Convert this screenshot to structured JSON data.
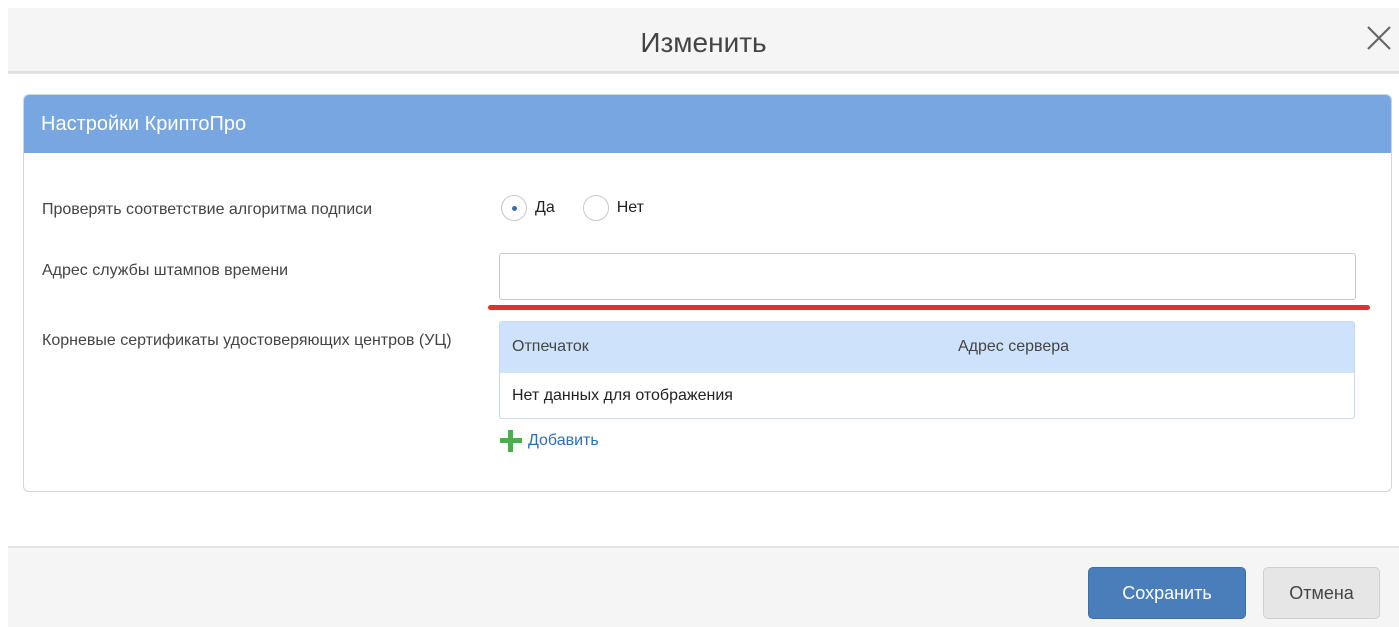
{
  "dialog": {
    "title": "Изменить"
  },
  "panel": {
    "title": "Настройки КриптоПро"
  },
  "form": {
    "verify_label": "Проверять соответствие алгоритма подписи",
    "radio_yes": "Да",
    "radio_no": "Нет",
    "selected": "yes",
    "tsa_label": "Адрес службы штампов времени",
    "tsa_value": "",
    "roots_label": "Корневые сертификаты удостоверяющих центров (УЦ)"
  },
  "grid": {
    "columns": [
      "Отпечаток",
      "Адрес сервера"
    ],
    "empty_text": "Нет данных для отображения"
  },
  "add_label": "Добавить",
  "buttons": {
    "save": "Сохранить",
    "cancel": "Отмена"
  },
  "colors": {
    "panel_header": "#78a6e0",
    "primary_button": "#4a7ebb",
    "highlight_underline": "#e0312a",
    "add_icon": "#4cae4c"
  },
  "icons": {
    "close": "close-icon",
    "add": "plus-icon"
  }
}
